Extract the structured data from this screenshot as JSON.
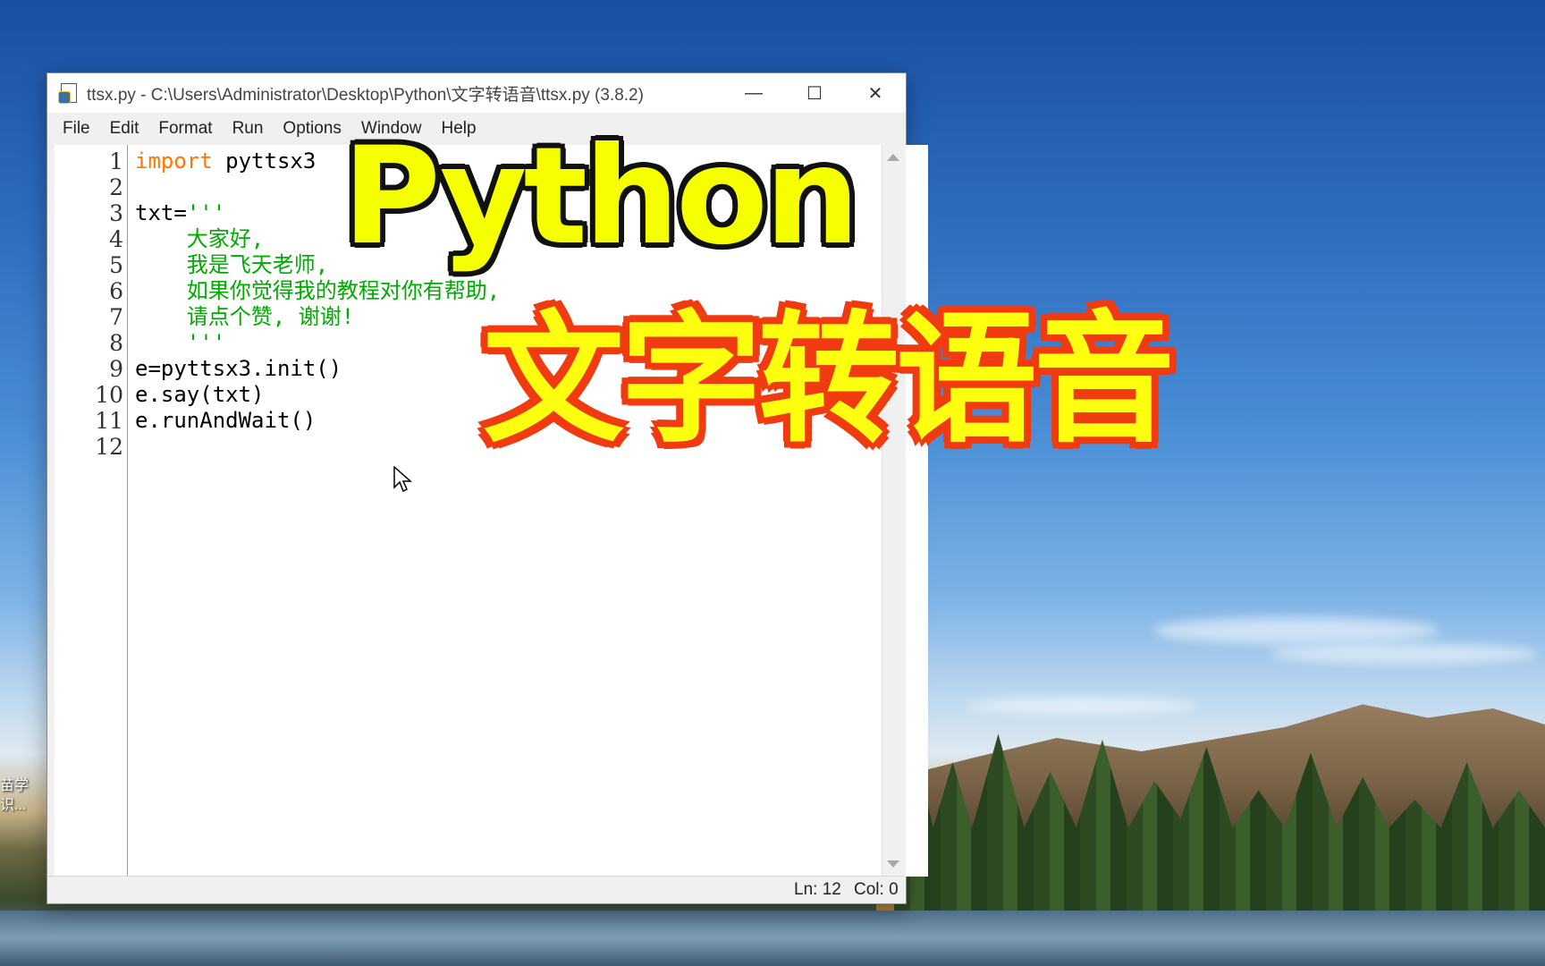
{
  "window": {
    "title": "ttsx.py - C:\\Users\\Administrator\\Desktop\\Python\\文字转语音\\ttsx.py (3.8.2)",
    "controls": {
      "minimize": "—",
      "maximize": "☐",
      "close": "✕"
    }
  },
  "menu": [
    "File",
    "Edit",
    "Format",
    "Run",
    "Options",
    "Window",
    "Help"
  ],
  "editor": {
    "line_numbers": [
      "1",
      "2",
      "3",
      "4",
      "5",
      "6",
      "7",
      "8",
      "9",
      "10",
      "11",
      "12"
    ],
    "lines": {
      "l1_kw": "import",
      "l1_rest": " pyttsx3",
      "l3_code": "txt=",
      "l3_str": "'''",
      "l4": "    大家好,",
      "l5": "    我是飞天老师,",
      "l6": "    如果你觉得我的教程对你有帮助,",
      "l7": "    请点个赞, 谢谢!",
      "l8": "    '''",
      "l9": "e=pyttsx3.init()",
      "l10": "e.say(txt)",
      "l11": "e.runAndWait()"
    },
    "colors": {
      "keyword": "#ff7700",
      "string": "#00aa00"
    }
  },
  "status": {
    "line": "Ln: 12",
    "col": "Col: 0"
  },
  "overlay": {
    "top": "Python",
    "bottom": "文字转语音"
  },
  "desktop": {
    "icon_label_1": "苗学",
    "icon_label_2": "识..."
  }
}
